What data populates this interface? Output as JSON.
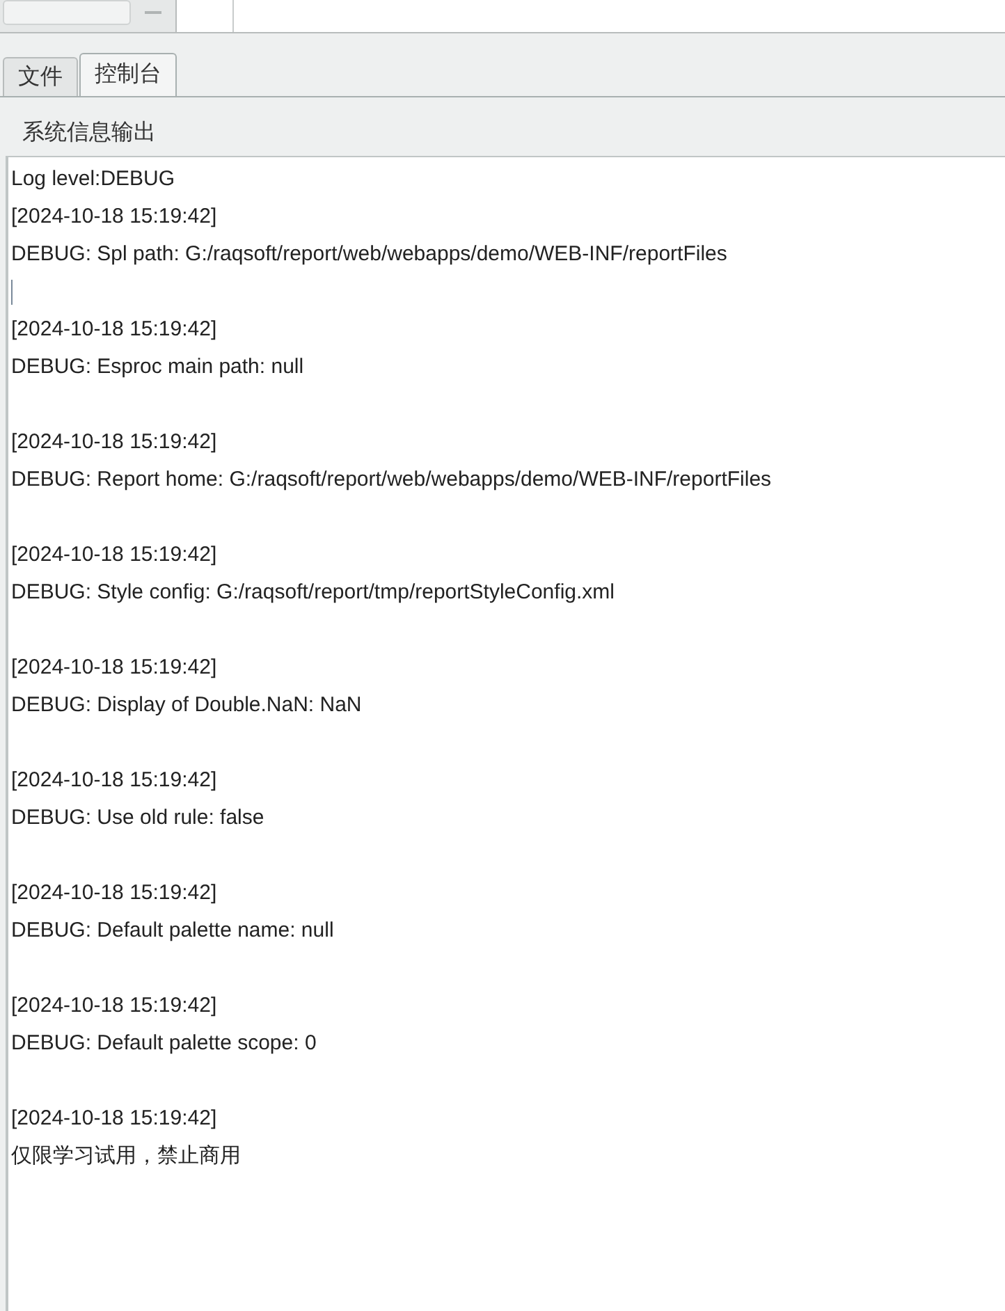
{
  "tabs": [
    {
      "label": "文件",
      "selected": false
    },
    {
      "label": "控制台",
      "selected": true
    }
  ],
  "panel": {
    "title": "系统信息输出"
  },
  "log": {
    "header": "Log level:DEBUG",
    "entries": [
      {
        "timestamp": "[2024-10-18 15:19:42]",
        "message": "DEBUG: Spl path: G:/raqsoft/report/web/webapps/demo/WEB-INF/reportFiles"
      },
      {
        "timestamp": "[2024-10-18 15:19:42]",
        "message": "DEBUG: Esproc main path: null"
      },
      {
        "timestamp": "[2024-10-18 15:19:42]",
        "message": "DEBUG: Report home: G:/raqsoft/report/web/webapps/demo/WEB-INF/reportFiles"
      },
      {
        "timestamp": "[2024-10-18 15:19:42]",
        "message": "DEBUG: Style config: G:/raqsoft/report/tmp/reportStyleConfig.xml"
      },
      {
        "timestamp": "[2024-10-18 15:19:42]",
        "message": "DEBUG: Display of Double.NaN: NaN"
      },
      {
        "timestamp": "[2024-10-18 15:19:42]",
        "message": "DEBUG: Use old rule: false"
      },
      {
        "timestamp": "[2024-10-18 15:19:42]",
        "message": "DEBUG: Default palette name: null"
      },
      {
        "timestamp": "[2024-10-18 15:19:42]",
        "message": "DEBUG: Default palette scope: 0"
      },
      {
        "timestamp": "[2024-10-18 15:19:42]",
        "message": "仅限学习试用，禁止商用"
      }
    ]
  }
}
